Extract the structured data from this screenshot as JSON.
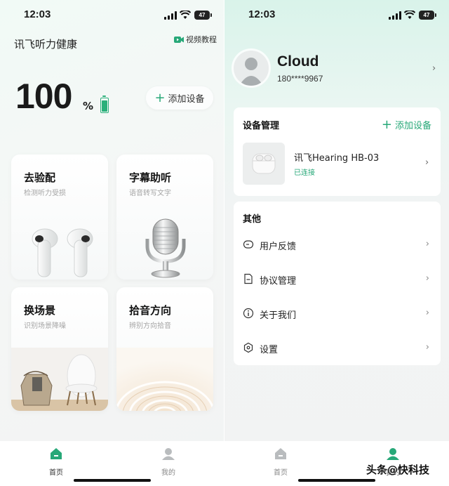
{
  "status": {
    "time": "12:03",
    "battery": "47"
  },
  "home": {
    "app_title": "讯飞听力健康",
    "battery_value": "100",
    "battery_unit": "%",
    "add_device": "添加设备",
    "cards": [
      {
        "title": "去验配",
        "subtitle": "检测听力受损"
      },
      {
        "title": "字幕助听",
        "subtitle": "语音转写文字"
      },
      {
        "title": "换场景",
        "subtitle": "识别场景降噪"
      },
      {
        "title": "拾音方向",
        "subtitle": "辨别方向拾音"
      }
    ],
    "tabs": [
      {
        "label": "首页",
        "active": true
      },
      {
        "label": "我的",
        "active": false
      }
    ]
  },
  "profile": {
    "video_tutorial": "视频教程",
    "username": "Cloud",
    "phone": "180****9967",
    "device_section": "设备管理",
    "add_device": "添加设备",
    "device_name": "讯飞Hearing HB-03",
    "device_status": "已连接",
    "other_section": "其他",
    "menu": [
      {
        "label": "用户反馈",
        "icon": "feedback-icon"
      },
      {
        "label": "协议管理",
        "icon": "document-icon"
      },
      {
        "label": "关于我们",
        "icon": "info-icon"
      },
      {
        "label": "设置",
        "icon": "settings-icon"
      }
    ],
    "tabs": [
      {
        "label": "首页",
        "active": false
      },
      {
        "label": "我的",
        "active": true
      }
    ]
  },
  "watermark": "头条@快科技",
  "colors": {
    "accent": "#27a878",
    "text": "#1a1a1a",
    "muted": "#a5a5a5"
  }
}
